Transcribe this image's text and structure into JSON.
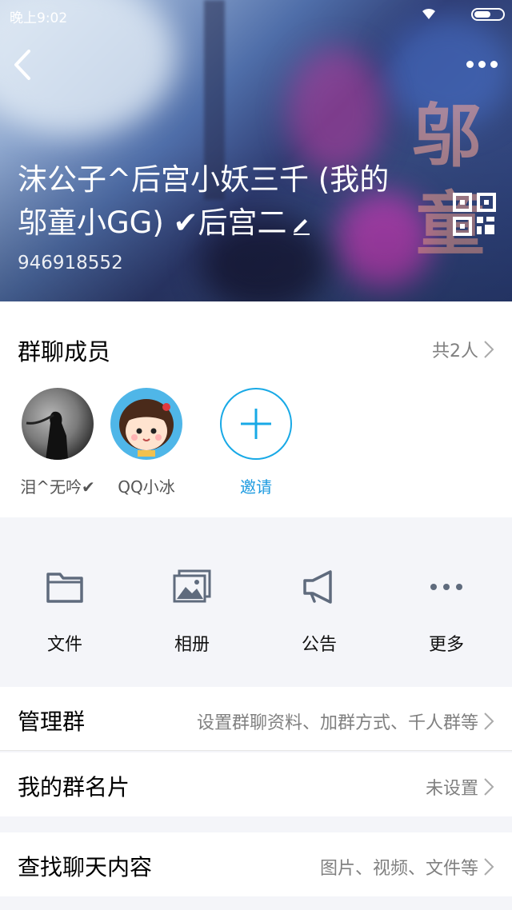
{
  "status_bar": {
    "time": "晚上9:02"
  },
  "group": {
    "name": "沫公子^后宫小妖三千 (我的邬童小GG) ✔后宫二",
    "id": "946918552"
  },
  "members": {
    "title": "群聊成员",
    "count_label": "共2人",
    "list": [
      {
        "name": "泪^无吟✔"
      },
      {
        "name": "QQ小冰"
      }
    ],
    "invite_label": "邀请"
  },
  "tools": [
    {
      "label": "文件",
      "icon": "folder-icon"
    },
    {
      "label": "相册",
      "icon": "album-icon"
    },
    {
      "label": "公告",
      "icon": "megaphone-icon"
    },
    {
      "label": "更多",
      "icon": "more-dots-icon"
    }
  ],
  "rows": [
    {
      "label": "管理群",
      "value": "设置群聊资料、加群方式、千人群等"
    },
    {
      "label": "我的群名片",
      "value": "未设置"
    },
    {
      "label": "查找聊天内容",
      "value": "图片、视频、文件等"
    }
  ],
  "colors": {
    "accent": "#18a9e6",
    "icon_gray": "#5f6b7d",
    "value_gray": "#808080"
  }
}
